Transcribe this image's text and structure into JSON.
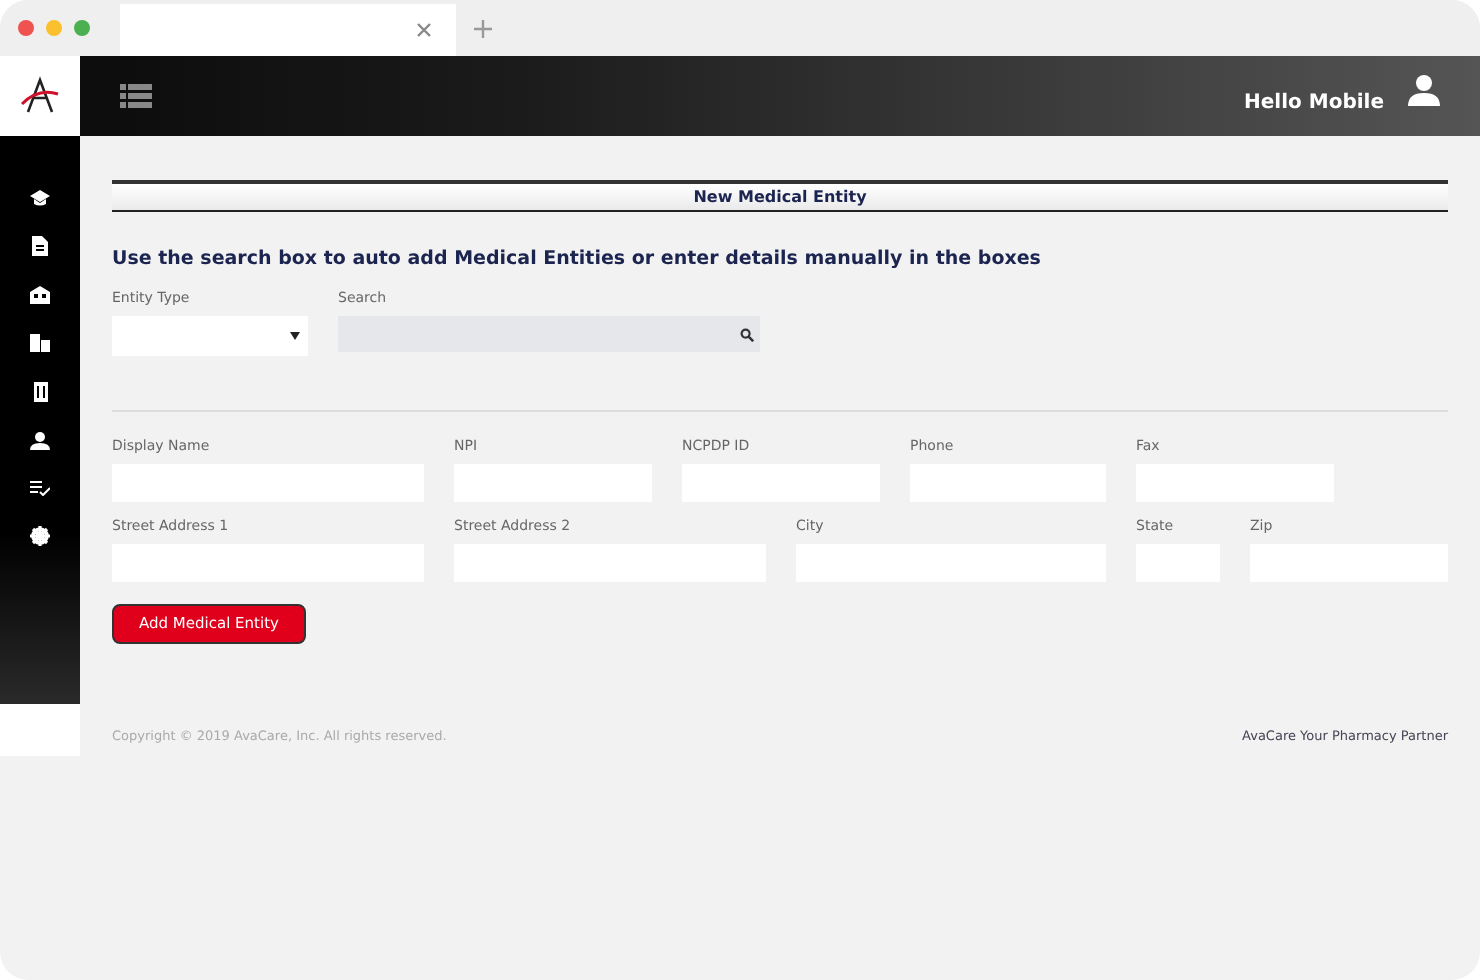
{
  "header": {
    "greeting": "Hello Mobile"
  },
  "page_title": "New Medical Entity",
  "instructions": "Use the search box to auto add Medical Entities or enter details manually in the boxes",
  "entity_type": {
    "label": "Entity Type"
  },
  "search": {
    "label": "Search"
  },
  "field_rows": [
    [
      {
        "label": "Display Name"
      },
      {
        "label": "NPI"
      },
      {
        "label": "NCPDP ID"
      },
      {
        "label": "Phone"
      },
      {
        "label": "Fax"
      }
    ],
    [
      {
        "label": "Street Address 1"
      },
      {
        "label": "Street Address 2"
      },
      {
        "label": "City"
      },
      {
        "label": "State"
      },
      {
        "label": "Zip"
      }
    ]
  ],
  "button": "Add Medical Entity",
  "footer": {
    "copyright": "Copyright © 2019 AvaCare, Inc. All rights reserved.",
    "tagline": "AvaCare Your Pharmacy Partner"
  }
}
